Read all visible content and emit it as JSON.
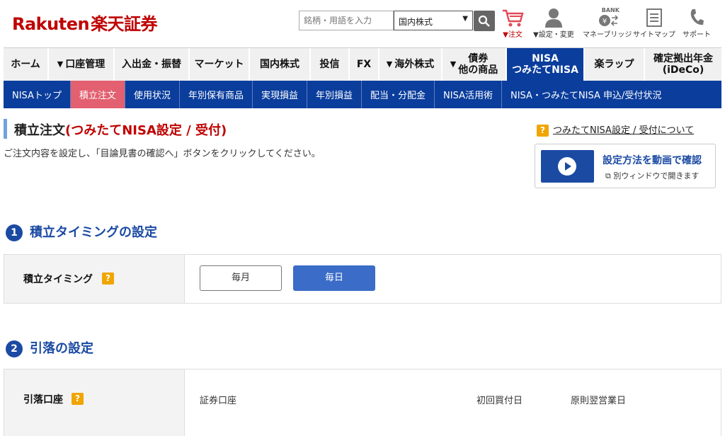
{
  "header": {
    "logo_en": "Rakuten",
    "logo_jp": "楽天証券",
    "search": {
      "placeholder": "銘柄・用語を入力",
      "select_value": "国内株式"
    },
    "icons": [
      {
        "label": "▼注文",
        "icon": "cart-icon"
      },
      {
        "label": "▼設定・変更",
        "icon": "user-icon"
      },
      {
        "label": "マネーブリッジ",
        "icon": "bank-icon",
        "badge": "BANK"
      },
      {
        "label": "サイトマップ",
        "icon": "sitemap-icon"
      },
      {
        "label": "サポート",
        "icon": "phone-icon"
      }
    ]
  },
  "main_nav": [
    {
      "label": "ホーム"
    },
    {
      "label": "口座管理",
      "dropdown": true
    },
    {
      "label": "入出金・振替"
    },
    {
      "label": "マーケット"
    },
    {
      "label": "国内株式"
    },
    {
      "label": "投信"
    },
    {
      "label": "FX"
    },
    {
      "label": "海外株式",
      "dropdown": true
    },
    {
      "label": "債券",
      "label2": "他の商品",
      "dropdown": true
    },
    {
      "label": "NISA",
      "label2": "つみたてNISA",
      "active": true
    },
    {
      "label": "楽ラップ"
    },
    {
      "label": "確定拠出年金",
      "label2": "(iDeCo)"
    }
  ],
  "sub_nav": [
    {
      "label": "NISAトップ"
    },
    {
      "label": "積立注文",
      "active": true
    },
    {
      "label": "使用状況"
    },
    {
      "label": "年別保有商品"
    },
    {
      "label": "実現損益"
    },
    {
      "label": "年別損益"
    },
    {
      "label": "配当・分配金"
    },
    {
      "label": "NISA活用術"
    },
    {
      "label": "NISA・つみたてNISA 申込/受付状況"
    }
  ],
  "page": {
    "title": "積立注文",
    "title_sub": "(つみたてNISA設定 / 受付)",
    "help_link": "つみたてNISA設定 / 受付について",
    "instruction": "ご注文内容を設定し、「目論見書の確認へ」ボタンをクリックしてください。",
    "video_title": "設定方法を動画で確認",
    "video_sub": "別ウィンドウで開きます"
  },
  "section1": {
    "num": "1",
    "title": "積立タイミングの設定",
    "row_label": "積立タイミング",
    "options": [
      "毎月",
      "毎日"
    ],
    "selected": "毎日"
  },
  "section2": {
    "num": "2",
    "title": "引落の設定",
    "row_label": "引落口座",
    "account": "証券口座",
    "first_buy_label": "初回買付日",
    "first_buy_value": "原則翌営業日"
  },
  "help_mark": "?",
  "colors": {
    "brand_red": "#bf0000",
    "nav_blue": "#0a3d9c",
    "active_pink": "#e2606f",
    "accent_blue": "#3b6cc8",
    "help_orange": "#f0a500"
  }
}
